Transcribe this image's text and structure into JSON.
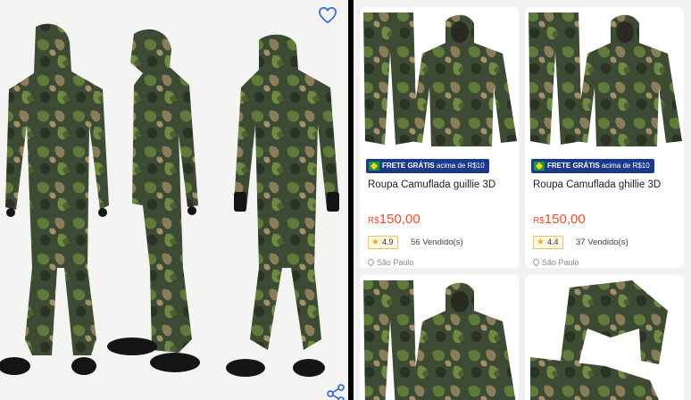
{
  "gallery": {
    "image_alt_icon": "camouflage-suit-photo",
    "favorite_icon": "heart-icon",
    "share_icon": "share-icon"
  },
  "products": [
    {
      "badge_prefix": "FRETE GRÁTIS",
      "badge_suffix": " acima de R$10",
      "title": "Roupa Camuflada guillie 3D",
      "currency": "R$",
      "price": "150,00",
      "rating": "4.9",
      "sold": "56 Vendido(s)",
      "location": "São Paulo"
    },
    {
      "badge_prefix": "FRETE GRÁTIS",
      "badge_suffix": " acima de R$10",
      "title": "Roupa Camuflada ghillie 3D",
      "currency": "R$",
      "price": "150,00",
      "rating": "4.4",
      "sold": "37 Vendido(s)",
      "location": "São Paulo"
    }
  ],
  "colors": {
    "price": "#ee4d2d",
    "badge_bg": "#1b3a8a",
    "rating_star": "#f0a81f",
    "favorite": "#3b6fd6"
  }
}
